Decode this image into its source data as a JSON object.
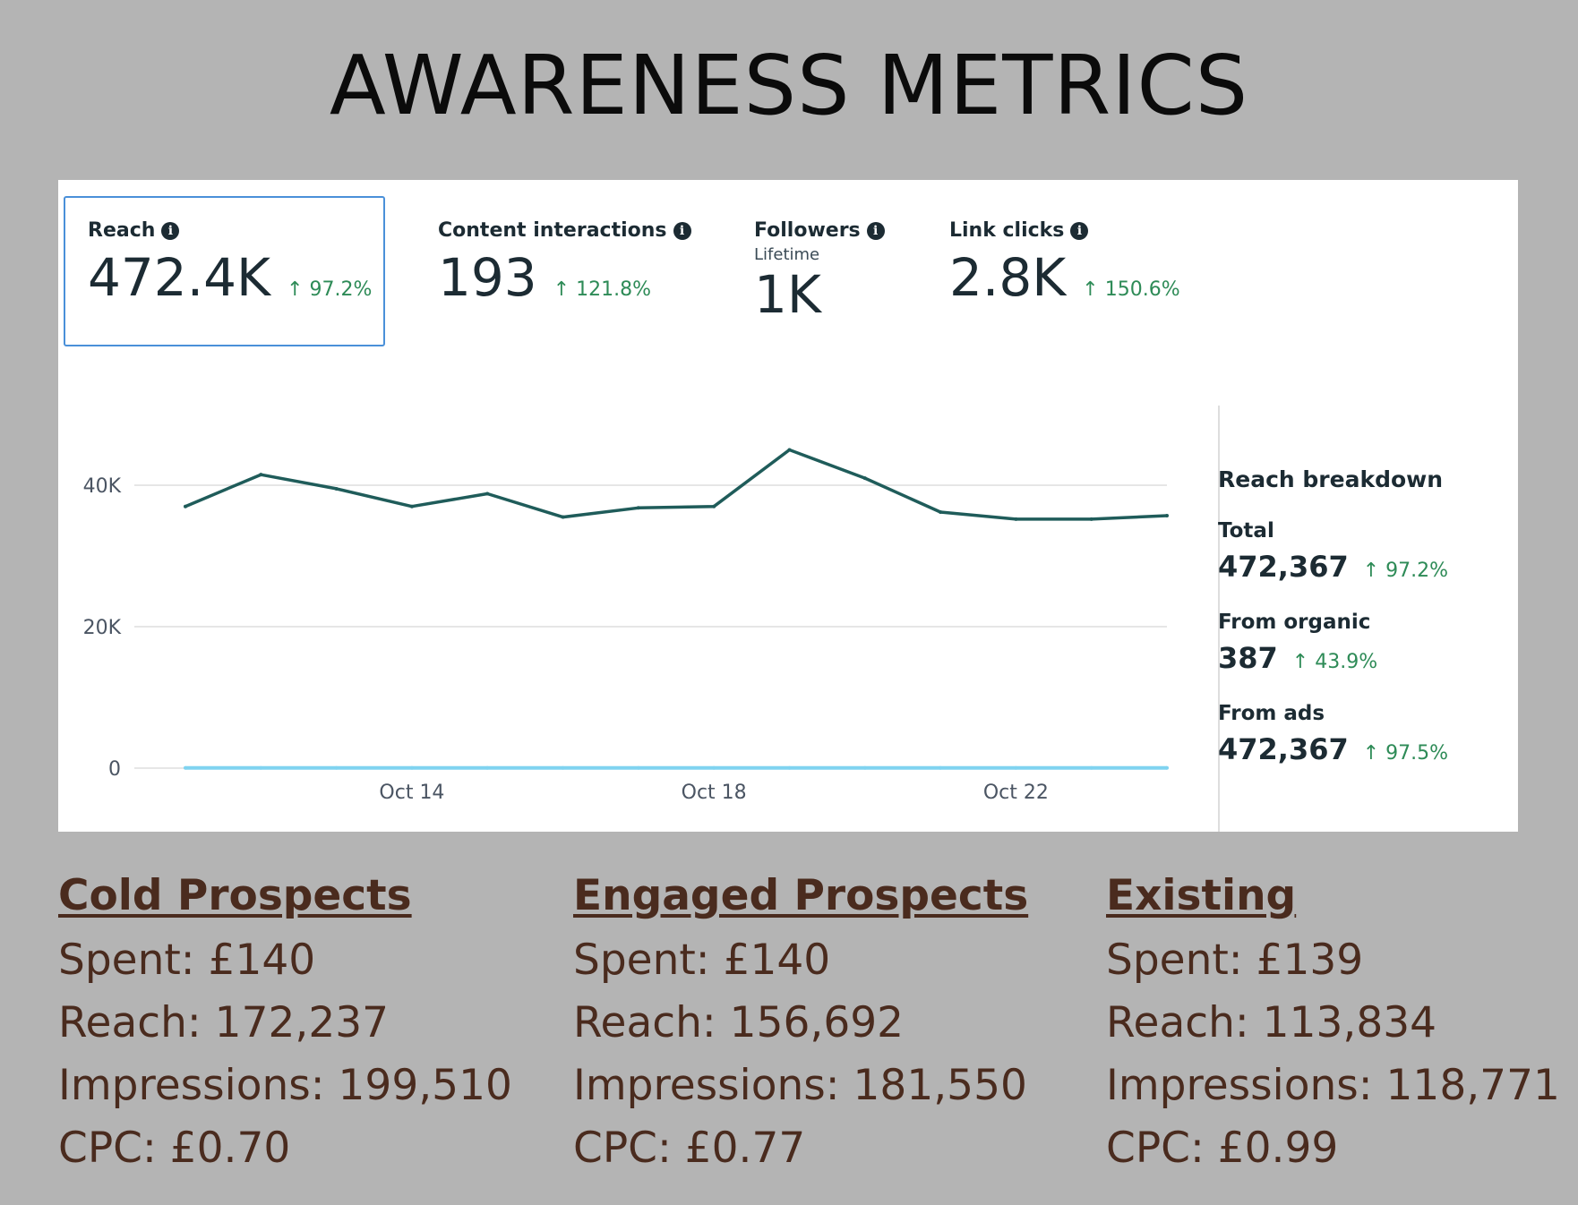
{
  "title": "AWARENESS METRICS",
  "metrics": [
    {
      "label": "Reach",
      "value": "472.4K",
      "change": "↑ 97.2%",
      "selected": true
    },
    {
      "label": "Content interactions",
      "value": "193",
      "change": "↑ 121.8%"
    },
    {
      "label": "Followers",
      "sub": "Lifetime",
      "value": "1K"
    },
    {
      "label": "Link clicks",
      "value": "2.8K",
      "change": "↑ 150.6%"
    }
  ],
  "breakdown": {
    "title": "Reach breakdown",
    "items": [
      {
        "label": "Total",
        "value": "472,367",
        "change": "↑ 97.2%"
      },
      {
        "label": "From organic",
        "value": "387",
        "change": "↑ 43.9%"
      },
      {
        "label": "From ads",
        "value": "472,367",
        "change": "↑ 97.5%"
      }
    ]
  },
  "segments": [
    {
      "title": "Cold Prospects",
      "spent": "Spent: £140",
      "reach": "Reach: 172,237",
      "impressions": "Impressions: 199,510",
      "cpc": "CPC: £0.70"
    },
    {
      "title": "Engaged Prospects",
      "spent": "Spent: £140",
      "reach": "Reach: 156,692",
      "impressions": "Impressions: 181,550",
      "cpc": "CPC: £0.77"
    },
    {
      "title": "Existing",
      "spent": "Spent: £139",
      "reach": "Reach: 113,834",
      "impressions": "Impressions: 118,771",
      "cpc": "CPC: £0.99"
    }
  ],
  "colors": {
    "background": "#b4b4b4",
    "line_total": "#1f5c5a",
    "line_organic": "#7fd3f0",
    "positive": "#2e8b57",
    "segment_text": "#4a2b1e",
    "selected_border": "#4a90d9"
  },
  "chart_data": {
    "type": "line",
    "x": [
      "Oct 11",
      "Oct 12",
      "Oct 13",
      "Oct 14",
      "Oct 15",
      "Oct 16",
      "Oct 17",
      "Oct 18",
      "Oct 19",
      "Oct 20",
      "Oct 21",
      "Oct 22",
      "Oct 23",
      "Oct 24"
    ],
    "x_ticks": [
      "Oct 14",
      "Oct 18",
      "Oct 22"
    ],
    "y_ticks": [
      "0",
      "20K",
      "40K"
    ],
    "ylim": [
      0,
      50000
    ],
    "grid": true,
    "series": [
      {
        "values": [
          37000,
          41500,
          39500,
          37000,
          38800,
          35500,
          36800,
          37000,
          45000,
          41000,
          36200,
          35200,
          35200,
          35700
        ]
      },
      {
        "values": [
          28,
          28,
          28,
          28,
          28,
          28,
          28,
          28,
          28,
          28,
          28,
          28,
          28,
          28
        ]
      }
    ]
  }
}
